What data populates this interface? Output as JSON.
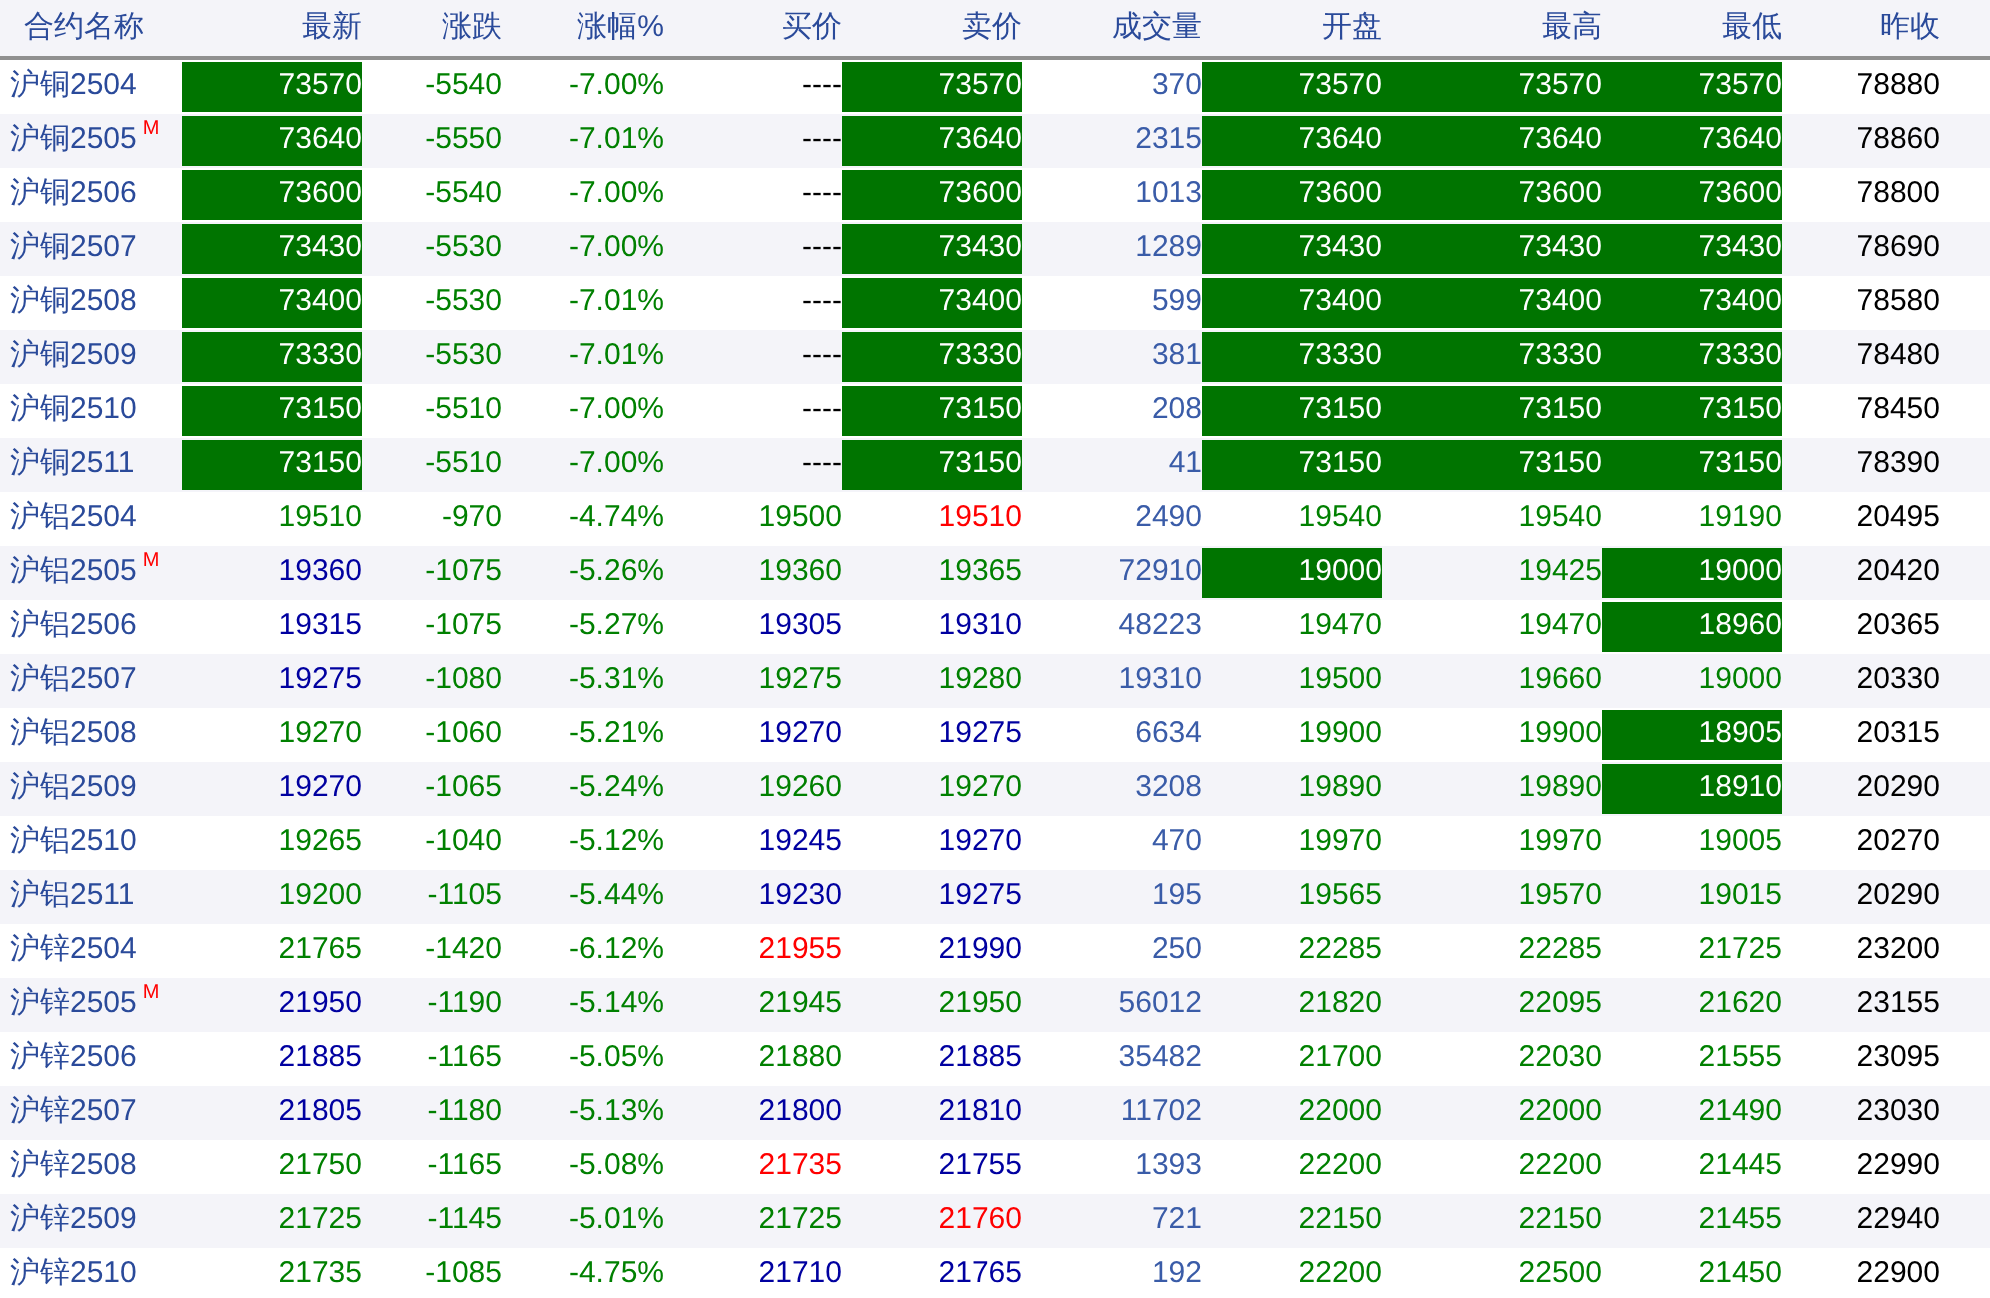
{
  "columns": [
    "合约名称",
    "最新",
    "涨跌",
    "涨幅%",
    "买价",
    "卖价",
    "成交量",
    "开盘",
    "最高",
    "最低",
    "昨收"
  ],
  "rows": [
    {
      "name": "沪铜2504",
      "cells": [
        {
          "text": "73570",
          "color": "#007400",
          "highlighted": true
        },
        {
          "text": "-5540",
          "color": "#008000",
          "highlighted": false
        },
        {
          "text": "-7.00%",
          "color": "#008000",
          "highlighted": false
        },
        {
          "text": "----",
          "color": "#000000",
          "highlighted": false
        },
        {
          "text": "73570",
          "color": "#007400",
          "highlighted": true
        },
        {
          "text": "370",
          "color": "#3a5ca8",
          "highlighted": false
        },
        {
          "text": "73570",
          "color": "#007400",
          "highlighted": true
        },
        {
          "text": "73570",
          "color": "#007400",
          "highlighted": true
        },
        {
          "text": "73570",
          "color": "#007400",
          "highlighted": true
        },
        {
          "text": "78880",
          "color": "#000000",
          "highlighted": false
        }
      ]
    },
    {
      "name": "沪铜2505",
      "tag": "M",
      "cells": [
        {
          "text": "73640",
          "color": "#007400",
          "highlighted": true
        },
        {
          "text": "-5550",
          "color": "#008000",
          "highlighted": false
        },
        {
          "text": "-7.01%",
          "color": "#008000",
          "highlighted": false
        },
        {
          "text": "----",
          "color": "#000000",
          "highlighted": false
        },
        {
          "text": "73640",
          "color": "#007400",
          "highlighted": true
        },
        {
          "text": "2315",
          "color": "#3a5ca8",
          "highlighted": false
        },
        {
          "text": "73640",
          "color": "#007400",
          "highlighted": true
        },
        {
          "text": "73640",
          "color": "#007400",
          "highlighted": true
        },
        {
          "text": "73640",
          "color": "#007400",
          "highlighted": true
        },
        {
          "text": "78860",
          "color": "#000000",
          "highlighted": false
        }
      ]
    },
    {
      "name": "沪铜2506",
      "cells": [
        {
          "text": "73600",
          "color": "#007400",
          "highlighted": true
        },
        {
          "text": "-5540",
          "color": "#008000",
          "highlighted": false
        },
        {
          "text": "-7.00%",
          "color": "#008000",
          "highlighted": false
        },
        {
          "text": "----",
          "color": "#000000",
          "highlighted": false
        },
        {
          "text": "73600",
          "color": "#007400",
          "highlighted": true
        },
        {
          "text": "1013",
          "color": "#3a5ca8",
          "highlighted": false
        },
        {
          "text": "73600",
          "color": "#007400",
          "highlighted": true
        },
        {
          "text": "73600",
          "color": "#007400",
          "highlighted": true
        },
        {
          "text": "73600",
          "color": "#007400",
          "highlighted": true
        },
        {
          "text": "78800",
          "color": "#000000",
          "highlighted": false
        }
      ]
    },
    {
      "name": "沪铜2507",
      "cells": [
        {
          "text": "73430",
          "color": "#007400",
          "highlighted": true
        },
        {
          "text": "-5530",
          "color": "#008000",
          "highlighted": false
        },
        {
          "text": "-7.00%",
          "color": "#008000",
          "highlighted": false
        },
        {
          "text": "----",
          "color": "#000000",
          "highlighted": false
        },
        {
          "text": "73430",
          "color": "#007400",
          "highlighted": true
        },
        {
          "text": "1289",
          "color": "#3a5ca8",
          "highlighted": false
        },
        {
          "text": "73430",
          "color": "#007400",
          "highlighted": true
        },
        {
          "text": "73430",
          "color": "#007400",
          "highlighted": true
        },
        {
          "text": "73430",
          "color": "#007400",
          "highlighted": true
        },
        {
          "text": "78690",
          "color": "#000000",
          "highlighted": false
        }
      ]
    },
    {
      "name": "沪铜2508",
      "cells": [
        {
          "text": "73400",
          "color": "#007400",
          "highlighted": true
        },
        {
          "text": "-5530",
          "color": "#008000",
          "highlighted": false
        },
        {
          "text": "-7.01%",
          "color": "#008000",
          "highlighted": false
        },
        {
          "text": "----",
          "color": "#000000",
          "highlighted": false
        },
        {
          "text": "73400",
          "color": "#007400",
          "highlighted": true
        },
        {
          "text": "599",
          "color": "#3a5ca8",
          "highlighted": false
        },
        {
          "text": "73400",
          "color": "#007400",
          "highlighted": true
        },
        {
          "text": "73400",
          "color": "#007400",
          "highlighted": true
        },
        {
          "text": "73400",
          "color": "#007400",
          "highlighted": true
        },
        {
          "text": "78580",
          "color": "#000000",
          "highlighted": false
        }
      ]
    },
    {
      "name": "沪铜2509",
      "cells": [
        {
          "text": "73330",
          "color": "#007400",
          "highlighted": true
        },
        {
          "text": "-5530",
          "color": "#008000",
          "highlighted": false
        },
        {
          "text": "-7.01%",
          "color": "#008000",
          "highlighted": false
        },
        {
          "text": "----",
          "color": "#000000",
          "highlighted": false
        },
        {
          "text": "73330",
          "color": "#007400",
          "highlighted": true
        },
        {
          "text": "381",
          "color": "#3a5ca8",
          "highlighted": false
        },
        {
          "text": "73330",
          "color": "#007400",
          "highlighted": true
        },
        {
          "text": "73330",
          "color": "#007400",
          "highlighted": true
        },
        {
          "text": "73330",
          "color": "#007400",
          "highlighted": true
        },
        {
          "text": "78480",
          "color": "#000000",
          "highlighted": false
        }
      ]
    },
    {
      "name": "沪铜2510",
      "cells": [
        {
          "text": "73150",
          "color": "#007400",
          "highlighted": true
        },
        {
          "text": "-5510",
          "color": "#008000",
          "highlighted": false
        },
        {
          "text": "-7.00%",
          "color": "#008000",
          "highlighted": false
        },
        {
          "text": "----",
          "color": "#000000",
          "highlighted": false
        },
        {
          "text": "73150",
          "color": "#007400",
          "highlighted": true
        },
        {
          "text": "208",
          "color": "#3a5ca8",
          "highlighted": false
        },
        {
          "text": "73150",
          "color": "#007400",
          "highlighted": true
        },
        {
          "text": "73150",
          "color": "#007400",
          "highlighted": true
        },
        {
          "text": "73150",
          "color": "#007400",
          "highlighted": true
        },
        {
          "text": "78450",
          "color": "#000000",
          "highlighted": false
        }
      ]
    },
    {
      "name": "沪铜2511",
      "cells": [
        {
          "text": "73150",
          "color": "#007400",
          "highlighted": true
        },
        {
          "text": "-5510",
          "color": "#008000",
          "highlighted": false
        },
        {
          "text": "-7.00%",
          "color": "#008000",
          "highlighted": false
        },
        {
          "text": "----",
          "color": "#000000",
          "highlighted": false
        },
        {
          "text": "73150",
          "color": "#007400",
          "highlighted": true
        },
        {
          "text": "41",
          "color": "#3a5ca8",
          "highlighted": false
        },
        {
          "text": "73150",
          "color": "#007400",
          "highlighted": true
        },
        {
          "text": "73150",
          "color": "#007400",
          "highlighted": true
        },
        {
          "text": "73150",
          "color": "#007400",
          "highlighted": true
        },
        {
          "text": "78390",
          "color": "#000000",
          "highlighted": false
        }
      ]
    },
    {
      "name": "沪铝2504",
      "cells": [
        {
          "text": "19510",
          "color": "#008000",
          "highlighted": false
        },
        {
          "text": "-970",
          "color": "#008000",
          "highlighted": false
        },
        {
          "text": "-4.74%",
          "color": "#008000",
          "highlighted": false
        },
        {
          "text": "19500",
          "color": "#008000",
          "highlighted": false
        },
        {
          "text": "19510",
          "color": "#ff0000",
          "highlighted": false
        },
        {
          "text": "2490",
          "color": "#3a5ca8",
          "highlighted": false
        },
        {
          "text": "19540",
          "color": "#008000",
          "highlighted": false
        },
        {
          "text": "19540",
          "color": "#008000",
          "highlighted": false
        },
        {
          "text": "19190",
          "color": "#008000",
          "highlighted": false
        },
        {
          "text": "20495",
          "color": "#000000",
          "highlighted": false
        }
      ]
    },
    {
      "name": "沪铝2505",
      "tag": "M",
      "cells": [
        {
          "text": "19360",
          "color": "#0000a0",
          "highlighted": false
        },
        {
          "text": "-1075",
          "color": "#008000",
          "highlighted": false
        },
        {
          "text": "-5.26%",
          "color": "#008000",
          "highlighted": false
        },
        {
          "text": "19360",
          "color": "#008000",
          "highlighted": false
        },
        {
          "text": "19365",
          "color": "#008000",
          "highlighted": false
        },
        {
          "text": "72910",
          "color": "#3a5ca8",
          "highlighted": false
        },
        {
          "text": "19000",
          "color": "#007400",
          "highlighted": true
        },
        {
          "text": "19425",
          "color": "#008000",
          "highlighted": false
        },
        {
          "text": "19000",
          "color": "#007400",
          "highlighted": true
        },
        {
          "text": "20420",
          "color": "#000000",
          "highlighted": false
        }
      ]
    },
    {
      "name": "沪铝2506",
      "cells": [
        {
          "text": "19315",
          "color": "#0000a0",
          "highlighted": false
        },
        {
          "text": "-1075",
          "color": "#008000",
          "highlighted": false
        },
        {
          "text": "-5.27%",
          "color": "#008000",
          "highlighted": false
        },
        {
          "text": "19305",
          "color": "#0000a0",
          "highlighted": false
        },
        {
          "text": "19310",
          "color": "#0000a0",
          "highlighted": false
        },
        {
          "text": "48223",
          "color": "#3a5ca8",
          "highlighted": false
        },
        {
          "text": "19470",
          "color": "#008000",
          "highlighted": false
        },
        {
          "text": "19470",
          "color": "#008000",
          "highlighted": false
        },
        {
          "text": "18960",
          "color": "#007400",
          "highlighted": true
        },
        {
          "text": "20365",
          "color": "#000000",
          "highlighted": false
        }
      ]
    },
    {
      "name": "沪铝2507",
      "cells": [
        {
          "text": "19275",
          "color": "#0000a0",
          "highlighted": false
        },
        {
          "text": "-1080",
          "color": "#008000",
          "highlighted": false
        },
        {
          "text": "-5.31%",
          "color": "#008000",
          "highlighted": false
        },
        {
          "text": "19275",
          "color": "#008000",
          "highlighted": false
        },
        {
          "text": "19280",
          "color": "#008000",
          "highlighted": false
        },
        {
          "text": "19310",
          "color": "#3a5ca8",
          "highlighted": false
        },
        {
          "text": "19500",
          "color": "#008000",
          "highlighted": false
        },
        {
          "text": "19660",
          "color": "#008000",
          "highlighted": false
        },
        {
          "text": "19000",
          "color": "#008000",
          "highlighted": false
        },
        {
          "text": "20330",
          "color": "#000000",
          "highlighted": false
        }
      ]
    },
    {
      "name": "沪铝2508",
      "cells": [
        {
          "text": "19270",
          "color": "#008000",
          "highlighted": false
        },
        {
          "text": "-1060",
          "color": "#008000",
          "highlighted": false
        },
        {
          "text": "-5.21%",
          "color": "#008000",
          "highlighted": false
        },
        {
          "text": "19270",
          "color": "#0000a0",
          "highlighted": false
        },
        {
          "text": "19275",
          "color": "#0000a0",
          "highlighted": false
        },
        {
          "text": "6634",
          "color": "#3a5ca8",
          "highlighted": false
        },
        {
          "text": "19900",
          "color": "#008000",
          "highlighted": false
        },
        {
          "text": "19900",
          "color": "#008000",
          "highlighted": false
        },
        {
          "text": "18905",
          "color": "#007400",
          "highlighted": true
        },
        {
          "text": "20315",
          "color": "#000000",
          "highlighted": false
        }
      ]
    },
    {
      "name": "沪铝2509",
      "cells": [
        {
          "text": "19270",
          "color": "#0000a0",
          "highlighted": false
        },
        {
          "text": "-1065",
          "color": "#008000",
          "highlighted": false
        },
        {
          "text": "-5.24%",
          "color": "#008000",
          "highlighted": false
        },
        {
          "text": "19260",
          "color": "#008000",
          "highlighted": false
        },
        {
          "text": "19270",
          "color": "#008000",
          "highlighted": false
        },
        {
          "text": "3208",
          "color": "#3a5ca8",
          "highlighted": false
        },
        {
          "text": "19890",
          "color": "#008000",
          "highlighted": false
        },
        {
          "text": "19890",
          "color": "#008000",
          "highlighted": false
        },
        {
          "text": "18910",
          "color": "#007400",
          "highlighted": true
        },
        {
          "text": "20290",
          "color": "#000000",
          "highlighted": false
        }
      ]
    },
    {
      "name": "沪铝2510",
      "cells": [
        {
          "text": "19265",
          "color": "#008000",
          "highlighted": false
        },
        {
          "text": "-1040",
          "color": "#008000",
          "highlighted": false
        },
        {
          "text": "-5.12%",
          "color": "#008000",
          "highlighted": false
        },
        {
          "text": "19245",
          "color": "#0000a0",
          "highlighted": false
        },
        {
          "text": "19270",
          "color": "#0000a0",
          "highlighted": false
        },
        {
          "text": "470",
          "color": "#3a5ca8",
          "highlighted": false
        },
        {
          "text": "19970",
          "color": "#008000",
          "highlighted": false
        },
        {
          "text": "19970",
          "color": "#008000",
          "highlighted": false
        },
        {
          "text": "19005",
          "color": "#008000",
          "highlighted": false
        },
        {
          "text": "20270",
          "color": "#000000",
          "highlighted": false
        }
      ]
    },
    {
      "name": "沪铝2511",
      "cells": [
        {
          "text": "19200",
          "color": "#008000",
          "highlighted": false
        },
        {
          "text": "-1105",
          "color": "#008000",
          "highlighted": false
        },
        {
          "text": "-5.44%",
          "color": "#008000",
          "highlighted": false
        },
        {
          "text": "19230",
          "color": "#0000a0",
          "highlighted": false
        },
        {
          "text": "19275",
          "color": "#0000a0",
          "highlighted": false
        },
        {
          "text": "195",
          "color": "#3a5ca8",
          "highlighted": false
        },
        {
          "text": "19565",
          "color": "#008000",
          "highlighted": false
        },
        {
          "text": "19570",
          "color": "#008000",
          "highlighted": false
        },
        {
          "text": "19015",
          "color": "#008000",
          "highlighted": false
        },
        {
          "text": "20290",
          "color": "#000000",
          "highlighted": false
        }
      ]
    },
    {
      "name": "沪锌2504",
      "cells": [
        {
          "text": "21765",
          "color": "#008000",
          "highlighted": false
        },
        {
          "text": "-1420",
          "color": "#008000",
          "highlighted": false
        },
        {
          "text": "-6.12%",
          "color": "#008000",
          "highlighted": false
        },
        {
          "text": "21955",
          "color": "#ff0000",
          "highlighted": false
        },
        {
          "text": "21990",
          "color": "#0000a0",
          "highlighted": false
        },
        {
          "text": "250",
          "color": "#3a5ca8",
          "highlighted": false
        },
        {
          "text": "22285",
          "color": "#008000",
          "highlighted": false
        },
        {
          "text": "22285",
          "color": "#008000",
          "highlighted": false
        },
        {
          "text": "21725",
          "color": "#008000",
          "highlighted": false
        },
        {
          "text": "23200",
          "color": "#000000",
          "highlighted": false
        }
      ]
    },
    {
      "name": "沪锌2505",
      "tag": "M",
      "cells": [
        {
          "text": "21950",
          "color": "#0000a0",
          "highlighted": false
        },
        {
          "text": "-1190",
          "color": "#008000",
          "highlighted": false
        },
        {
          "text": "-5.14%",
          "color": "#008000",
          "highlighted": false
        },
        {
          "text": "21945",
          "color": "#008000",
          "highlighted": false
        },
        {
          "text": "21950",
          "color": "#008000",
          "highlighted": false
        },
        {
          "text": "56012",
          "color": "#3a5ca8",
          "highlighted": false
        },
        {
          "text": "21820",
          "color": "#008000",
          "highlighted": false
        },
        {
          "text": "22095",
          "color": "#008000",
          "highlighted": false
        },
        {
          "text": "21620",
          "color": "#008000",
          "highlighted": false
        },
        {
          "text": "23155",
          "color": "#000000",
          "highlighted": false
        }
      ]
    },
    {
      "name": "沪锌2506",
      "cells": [
        {
          "text": "21885",
          "color": "#0000a0",
          "highlighted": false
        },
        {
          "text": "-1165",
          "color": "#008000",
          "highlighted": false
        },
        {
          "text": "-5.05%",
          "color": "#008000",
          "highlighted": false
        },
        {
          "text": "21880",
          "color": "#008000",
          "highlighted": false
        },
        {
          "text": "21885",
          "color": "#0000a0",
          "highlighted": false
        },
        {
          "text": "35482",
          "color": "#3a5ca8",
          "highlighted": false
        },
        {
          "text": "21700",
          "color": "#008000",
          "highlighted": false
        },
        {
          "text": "22030",
          "color": "#008000",
          "highlighted": false
        },
        {
          "text": "21555",
          "color": "#008000",
          "highlighted": false
        },
        {
          "text": "23095",
          "color": "#000000",
          "highlighted": false
        }
      ]
    },
    {
      "name": "沪锌2507",
      "cells": [
        {
          "text": "21805",
          "color": "#0000a0",
          "highlighted": false
        },
        {
          "text": "-1180",
          "color": "#008000",
          "highlighted": false
        },
        {
          "text": "-5.13%",
          "color": "#008000",
          "highlighted": false
        },
        {
          "text": "21800",
          "color": "#0000a0",
          "highlighted": false
        },
        {
          "text": "21810",
          "color": "#0000a0",
          "highlighted": false
        },
        {
          "text": "11702",
          "color": "#3a5ca8",
          "highlighted": false
        },
        {
          "text": "22000",
          "color": "#008000",
          "highlighted": false
        },
        {
          "text": "22000",
          "color": "#008000",
          "highlighted": false
        },
        {
          "text": "21490",
          "color": "#008000",
          "highlighted": false
        },
        {
          "text": "23030",
          "color": "#000000",
          "highlighted": false
        }
      ]
    },
    {
      "name": "沪锌2508",
      "cells": [
        {
          "text": "21750",
          "color": "#008000",
          "highlighted": false
        },
        {
          "text": "-1165",
          "color": "#008000",
          "highlighted": false
        },
        {
          "text": "-5.08%",
          "color": "#008000",
          "highlighted": false
        },
        {
          "text": "21735",
          "color": "#ff0000",
          "highlighted": false
        },
        {
          "text": "21755",
          "color": "#0000a0",
          "highlighted": false
        },
        {
          "text": "1393",
          "color": "#3a5ca8",
          "highlighted": false
        },
        {
          "text": "22200",
          "color": "#008000",
          "highlighted": false
        },
        {
          "text": "22200",
          "color": "#008000",
          "highlighted": false
        },
        {
          "text": "21445",
          "color": "#008000",
          "highlighted": false
        },
        {
          "text": "22990",
          "color": "#000000",
          "highlighted": false
        }
      ]
    },
    {
      "name": "沪锌2509",
      "cells": [
        {
          "text": "21725",
          "color": "#008000",
          "highlighted": false
        },
        {
          "text": "-1145",
          "color": "#008000",
          "highlighted": false
        },
        {
          "text": "-5.01%",
          "color": "#008000",
          "highlighted": false
        },
        {
          "text": "21725",
          "color": "#008000",
          "highlighted": false
        },
        {
          "text": "21760",
          "color": "#ff0000",
          "highlighted": false
        },
        {
          "text": "721",
          "color": "#3a5ca8",
          "highlighted": false
        },
        {
          "text": "22150",
          "color": "#008000",
          "highlighted": false
        },
        {
          "text": "22150",
          "color": "#008000",
          "highlighted": false
        },
        {
          "text": "21455",
          "color": "#008000",
          "highlighted": false
        },
        {
          "text": "22940",
          "color": "#000000",
          "highlighted": false
        }
      ]
    },
    {
      "name": "沪锌2510",
      "cells": [
        {
          "text": "21735",
          "color": "#008000",
          "highlighted": false
        },
        {
          "text": "-1085",
          "color": "#008000",
          "highlighted": false
        },
        {
          "text": "-4.75%",
          "color": "#008000",
          "highlighted": false
        },
        {
          "text": "21710",
          "color": "#0000a0",
          "highlighted": false
        },
        {
          "text": "21765",
          "color": "#0000a0",
          "highlighted": false
        },
        {
          "text": "192",
          "color": "#3a5ca8",
          "highlighted": false
        },
        {
          "text": "22200",
          "color": "#008000",
          "highlighted": false
        },
        {
          "text": "22500",
          "color": "#008000",
          "highlighted": false
        },
        {
          "text": "21450",
          "color": "#008000",
          "highlighted": false
        },
        {
          "text": "22900",
          "color": "#000000",
          "highlighted": false
        }
      ]
    }
  ]
}
